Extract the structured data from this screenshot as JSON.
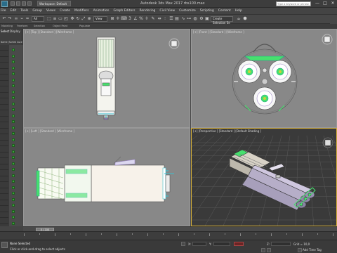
{
  "titlebar": {
    "workspace": "Workspace: Default",
    "title": "Autodesk 3ds Max 2017     rbs100.max",
    "search_placeholder": "Type a keyword or phrase",
    "minimize": "—",
    "maximize": "□",
    "close": "✕"
  },
  "menu": [
    "File",
    "Edit",
    "Tools",
    "Group",
    "Views",
    "Create",
    "Modifiers",
    "Animation",
    "Graph Editors",
    "Rendering",
    "Civil View",
    "Customize",
    "Scripting",
    "Content",
    "Help"
  ],
  "toolbar": {
    "filter_value": "All",
    "view_value": "View",
    "selection_set_placeholder": "Create Selection Se"
  },
  "ribbon_tabs": [
    "Modeling",
    "Freeform",
    "Selection",
    "Object Paint",
    "Populate"
  ],
  "explorer": {
    "tabs": [
      "Select",
      "Display"
    ],
    "column_header": "Name (Sorted Asce"
  },
  "viewports": {
    "top": "[+] [Top ] [Standard ] [Wireframe ]",
    "front": "[+] [Front ] [Standard ] [Wireframe ]",
    "left": "[+] [Left ] [Standard ] [Wireframe ]",
    "perspective": "[+] [Perspective ] [Standard ] [Default Shading ]"
  },
  "timeline": {
    "slider_label": "0 / 100"
  },
  "status": {
    "selection": "None Selected",
    "hint": "Click or click-and-drag to select objects",
    "x_label": "X:",
    "y_label": "Y:",
    "z_label": "Z:",
    "grid": "Grid = 10,0",
    "add_time_tag": "Add Time Tag"
  },
  "colors": {
    "accent_active_viewport": "#d7b13a",
    "object_green": "#47e06e",
    "object_white": "#f4f4f0",
    "object_purple": "#9d86c8"
  }
}
